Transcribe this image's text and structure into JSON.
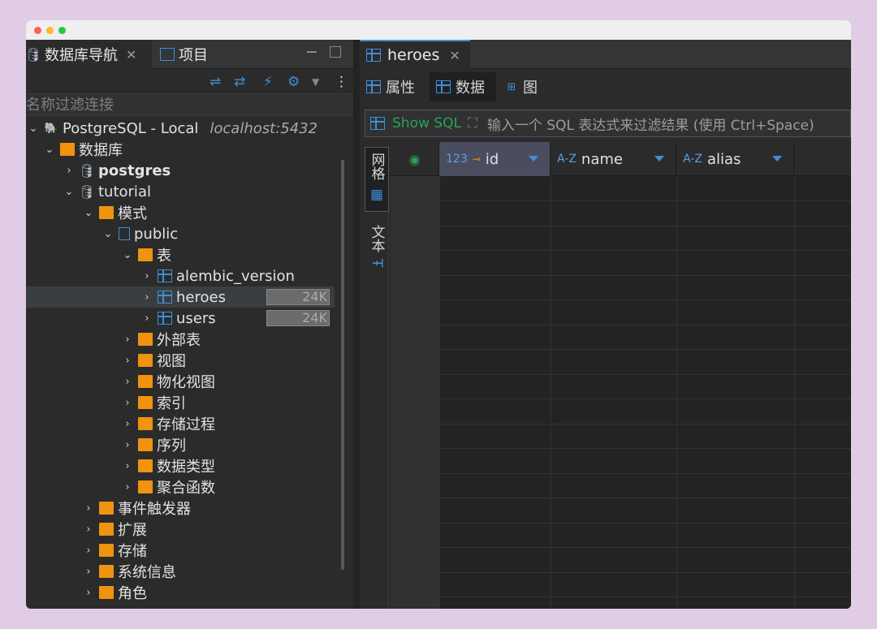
{
  "left_panel": {
    "tabs": [
      {
        "label": "数据库导航",
        "close": "✕"
      },
      {
        "label": "项目"
      }
    ],
    "filter_placeholder": "按名称过滤连接",
    "tree": [
      {
        "label": "PostgreSQL - Local",
        "extra": "localhost:5432"
      },
      {
        "label": "数据库"
      },
      {
        "label": "postgres"
      },
      {
        "label": "tutorial"
      },
      {
        "label": "模式"
      },
      {
        "label": "public"
      },
      {
        "label": "表"
      },
      {
        "label": "alembic_version"
      },
      {
        "label": "heroes",
        "size": "24K"
      },
      {
        "label": "users",
        "size": "24K"
      },
      {
        "label": "外部表"
      },
      {
        "label": "视图"
      },
      {
        "label": "物化视图"
      },
      {
        "label": "索引"
      },
      {
        "label": "存储过程"
      },
      {
        "label": "序列"
      },
      {
        "label": "数据类型"
      },
      {
        "label": "聚合函数"
      },
      {
        "label": "事件触发器"
      },
      {
        "label": "扩展"
      },
      {
        "label": "存储"
      },
      {
        "label": "系统信息"
      },
      {
        "label": "角色"
      }
    ]
  },
  "right_panel": {
    "editor_tab": {
      "label": "heroes",
      "close": "✕"
    },
    "subtabs": [
      "属性",
      "数据",
      "图"
    ],
    "filter": {
      "show_sql": "Show SQL",
      "hint": "输入一个 SQL 表达式来过滤结果 (使用 Ctrl+Space)"
    },
    "vertical_tabs": [
      "网格",
      "文本"
    ],
    "columns": [
      {
        "type": "123",
        "name": "id"
      },
      {
        "type": "A-Z",
        "name": "name"
      },
      {
        "type": "A-Z",
        "name": "alias"
      }
    ]
  },
  "colors": {
    "accent": "#3d8fd6",
    "folder": "#f0930f",
    "show_sql": "#2ea05a"
  }
}
